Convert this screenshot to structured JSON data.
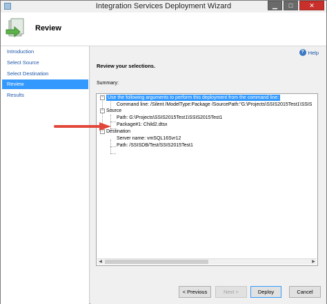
{
  "window": {
    "title": "Integration Services Deployment Wizard",
    "controls": {
      "minimize": "▁",
      "maximize": "□",
      "close": "✕"
    }
  },
  "header": {
    "title": "Review",
    "icon": "deployment-wizard-icon"
  },
  "sidebar": {
    "items": [
      {
        "label": "Introduction",
        "selected": false
      },
      {
        "label": "Select Source",
        "selected": false
      },
      {
        "label": "Select Destination",
        "selected": false
      },
      {
        "label": "Review",
        "selected": true
      },
      {
        "label": "Results",
        "selected": false
      }
    ]
  },
  "main": {
    "help_label": "Help",
    "heading": "Review your selections.",
    "summary_label": "Summary:",
    "tree": {
      "command_header": "Use the following arguments to perform this deployment from the command line:",
      "command_line": "Command line: /Silent /ModelType:Package /SourcePath:\"G:\\Projects\\SSIS2015Test1\\SSIS",
      "source_label": "Source",
      "source_path": "Path: G:\\Projects\\SSIS2015Test1\\SSIS2015Test1",
      "package": "Package#1: Child2.dtsx",
      "destination_label": "Destination",
      "server_name": "Server name: vmSQL16Svr12",
      "dest_path": "Path: /SSISDB/Test/SSIS2015Test1"
    }
  },
  "footer": {
    "previous": "< Previous",
    "next": "Next >",
    "deploy": "Deploy",
    "cancel": "Cancel"
  },
  "colors": {
    "selection": "#3399ff",
    "link": "#1c56a8",
    "arrow": "#e0473a",
    "close": "#c9302c"
  }
}
